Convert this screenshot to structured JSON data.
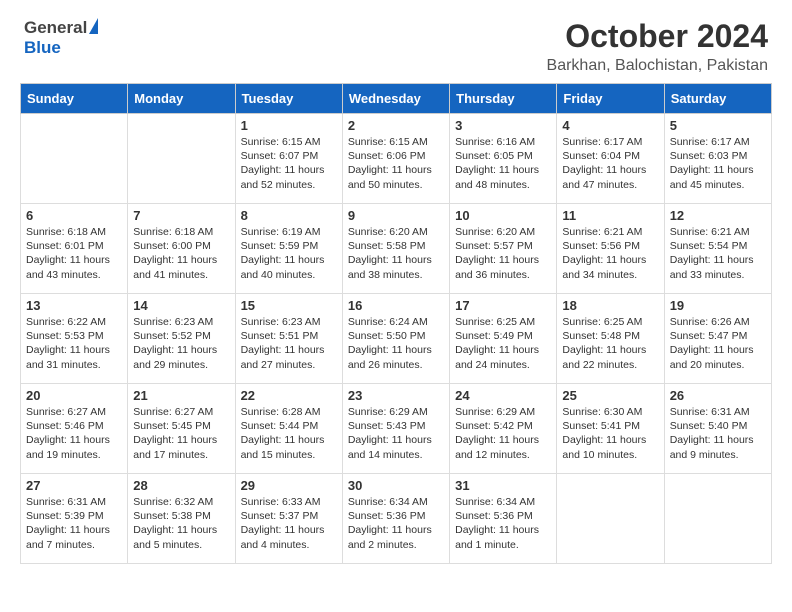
{
  "logo": {
    "general": "General",
    "blue": "Blue"
  },
  "title": "October 2024",
  "location": "Barkhan, Balochistan, Pakistan",
  "days_of_week": [
    "Sunday",
    "Monday",
    "Tuesday",
    "Wednesday",
    "Thursday",
    "Friday",
    "Saturday"
  ],
  "weeks": [
    [
      {
        "day": "",
        "info": ""
      },
      {
        "day": "",
        "info": ""
      },
      {
        "day": "1",
        "info": "Sunrise: 6:15 AM\nSunset: 6:07 PM\nDaylight: 11 hours and 52 minutes."
      },
      {
        "day": "2",
        "info": "Sunrise: 6:15 AM\nSunset: 6:06 PM\nDaylight: 11 hours and 50 minutes."
      },
      {
        "day": "3",
        "info": "Sunrise: 6:16 AM\nSunset: 6:05 PM\nDaylight: 11 hours and 48 minutes."
      },
      {
        "day": "4",
        "info": "Sunrise: 6:17 AM\nSunset: 6:04 PM\nDaylight: 11 hours and 47 minutes."
      },
      {
        "day": "5",
        "info": "Sunrise: 6:17 AM\nSunset: 6:03 PM\nDaylight: 11 hours and 45 minutes."
      }
    ],
    [
      {
        "day": "6",
        "info": "Sunrise: 6:18 AM\nSunset: 6:01 PM\nDaylight: 11 hours and 43 minutes."
      },
      {
        "day": "7",
        "info": "Sunrise: 6:18 AM\nSunset: 6:00 PM\nDaylight: 11 hours and 41 minutes."
      },
      {
        "day": "8",
        "info": "Sunrise: 6:19 AM\nSunset: 5:59 PM\nDaylight: 11 hours and 40 minutes."
      },
      {
        "day": "9",
        "info": "Sunrise: 6:20 AM\nSunset: 5:58 PM\nDaylight: 11 hours and 38 minutes."
      },
      {
        "day": "10",
        "info": "Sunrise: 6:20 AM\nSunset: 5:57 PM\nDaylight: 11 hours and 36 minutes."
      },
      {
        "day": "11",
        "info": "Sunrise: 6:21 AM\nSunset: 5:56 PM\nDaylight: 11 hours and 34 minutes."
      },
      {
        "day": "12",
        "info": "Sunrise: 6:21 AM\nSunset: 5:54 PM\nDaylight: 11 hours and 33 minutes."
      }
    ],
    [
      {
        "day": "13",
        "info": "Sunrise: 6:22 AM\nSunset: 5:53 PM\nDaylight: 11 hours and 31 minutes."
      },
      {
        "day": "14",
        "info": "Sunrise: 6:23 AM\nSunset: 5:52 PM\nDaylight: 11 hours and 29 minutes."
      },
      {
        "day": "15",
        "info": "Sunrise: 6:23 AM\nSunset: 5:51 PM\nDaylight: 11 hours and 27 minutes."
      },
      {
        "day": "16",
        "info": "Sunrise: 6:24 AM\nSunset: 5:50 PM\nDaylight: 11 hours and 26 minutes."
      },
      {
        "day": "17",
        "info": "Sunrise: 6:25 AM\nSunset: 5:49 PM\nDaylight: 11 hours and 24 minutes."
      },
      {
        "day": "18",
        "info": "Sunrise: 6:25 AM\nSunset: 5:48 PM\nDaylight: 11 hours and 22 minutes."
      },
      {
        "day": "19",
        "info": "Sunrise: 6:26 AM\nSunset: 5:47 PM\nDaylight: 11 hours and 20 minutes."
      }
    ],
    [
      {
        "day": "20",
        "info": "Sunrise: 6:27 AM\nSunset: 5:46 PM\nDaylight: 11 hours and 19 minutes."
      },
      {
        "day": "21",
        "info": "Sunrise: 6:27 AM\nSunset: 5:45 PM\nDaylight: 11 hours and 17 minutes."
      },
      {
        "day": "22",
        "info": "Sunrise: 6:28 AM\nSunset: 5:44 PM\nDaylight: 11 hours and 15 minutes."
      },
      {
        "day": "23",
        "info": "Sunrise: 6:29 AM\nSunset: 5:43 PM\nDaylight: 11 hours and 14 minutes."
      },
      {
        "day": "24",
        "info": "Sunrise: 6:29 AM\nSunset: 5:42 PM\nDaylight: 11 hours and 12 minutes."
      },
      {
        "day": "25",
        "info": "Sunrise: 6:30 AM\nSunset: 5:41 PM\nDaylight: 11 hours and 10 minutes."
      },
      {
        "day": "26",
        "info": "Sunrise: 6:31 AM\nSunset: 5:40 PM\nDaylight: 11 hours and 9 minutes."
      }
    ],
    [
      {
        "day": "27",
        "info": "Sunrise: 6:31 AM\nSunset: 5:39 PM\nDaylight: 11 hours and 7 minutes."
      },
      {
        "day": "28",
        "info": "Sunrise: 6:32 AM\nSunset: 5:38 PM\nDaylight: 11 hours and 5 minutes."
      },
      {
        "day": "29",
        "info": "Sunrise: 6:33 AM\nSunset: 5:37 PM\nDaylight: 11 hours and 4 minutes."
      },
      {
        "day": "30",
        "info": "Sunrise: 6:34 AM\nSunset: 5:36 PM\nDaylight: 11 hours and 2 minutes."
      },
      {
        "day": "31",
        "info": "Sunrise: 6:34 AM\nSunset: 5:36 PM\nDaylight: 11 hours and 1 minute."
      },
      {
        "day": "",
        "info": ""
      },
      {
        "day": "",
        "info": ""
      }
    ]
  ]
}
